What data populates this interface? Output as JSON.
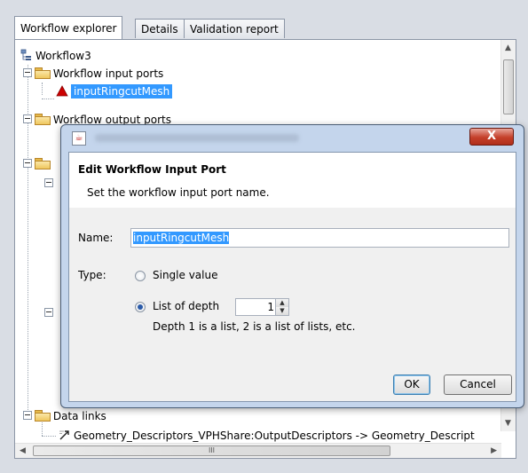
{
  "tabs": [
    {
      "label": "Workflow explorer"
    },
    {
      "label": "Details"
    },
    {
      "label": "Validation report"
    }
  ],
  "tree": {
    "root": "Workflow3",
    "input_ports_folder": "Workflow input ports",
    "input_port": "inputRingcutMesh",
    "output_ports_folder": "Workflow output ports",
    "data_links_folder": "Data links",
    "link": "Geometry_Descriptors_VPHShare:OutputDescriptors -> Geometry_Descript"
  },
  "dialog": {
    "close_label": "X",
    "header_title": "Edit Workflow Input Port",
    "header_subtitle": "Set the workflow input port name.",
    "name_label": "Name:",
    "name_value": "inputRingcutMesh",
    "type_label": "Type:",
    "option_single": "Single value",
    "option_list": "List of depth",
    "selected_option": "List of depth",
    "depth_value": "1",
    "depth_hint": "Depth 1 is a list, 2 is a list of lists, etc.",
    "ok_label": "OK",
    "cancel_label": "Cancel"
  },
  "scrollbar": {
    "grip": "III",
    "left_arrow": "◀",
    "right_arrow": "▶",
    "up_arrow": "▲",
    "down_arrow": "▼"
  },
  "colors": {
    "selection": "#3399ff",
    "error_triangle": "#cc0000",
    "close_button": "#c4402a"
  }
}
